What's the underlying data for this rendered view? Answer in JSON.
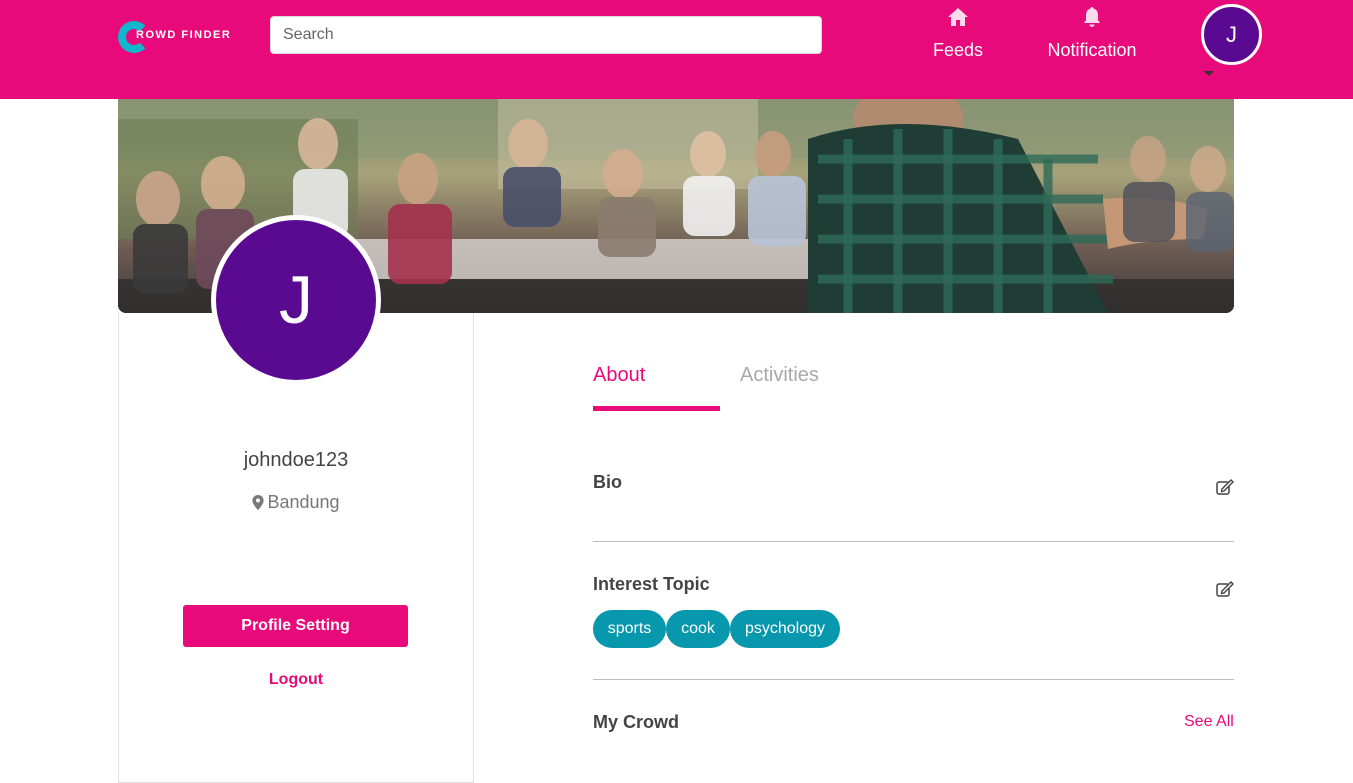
{
  "navbar": {
    "logo_text": "ROWD FINDER",
    "search_placeholder": "Search",
    "feeds_label": "Feeds",
    "notification_label": "Notification",
    "avatar_initial": "J"
  },
  "profile": {
    "avatar_initial": "J",
    "username": "johndoe123",
    "location": "Bandung",
    "setting_button": "Profile Setting",
    "logout_label": "Logout"
  },
  "tabs": [
    {
      "label": "About",
      "active": true
    },
    {
      "label": "Activities",
      "active": false
    }
  ],
  "sections": {
    "bio_title": "Bio",
    "interest_title": "Interest Topic",
    "crowd_title": "My Crowd",
    "see_all": "See All"
  },
  "interests": [
    "sports",
    "cook",
    "psychology"
  ],
  "colors": {
    "brand": "#e8097a",
    "avatar": "#5a0a91",
    "tag": "#0898ad",
    "logo_accent": "#10b6cc"
  }
}
